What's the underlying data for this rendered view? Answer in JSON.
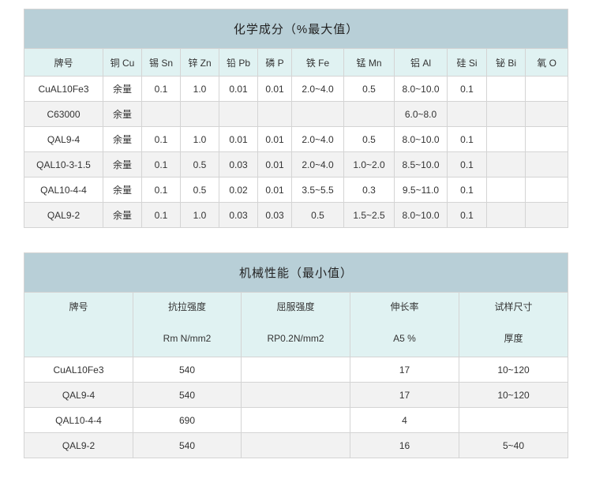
{
  "chem": {
    "title": "化学成分（%最大值）",
    "headers": [
      "牌号",
      "铜 Cu",
      "锡 Sn",
      "锌 Zn",
      "铅 Pb",
      "磷 P",
      "铁 Fe",
      "锰 Mn",
      "铝 Al",
      "硅 Si",
      "铋 Bi",
      "氧 O"
    ],
    "rows": [
      [
        "CuAL10Fe3",
        "余量",
        "0.1",
        "1.0",
        "0.01",
        "0.01",
        "2.0~4.0",
        "0.5",
        "8.0~10.0",
        "0.1",
        "",
        ""
      ],
      [
        "C63000",
        "余量",
        "",
        "",
        "",
        "",
        "",
        "",
        "6.0~8.0",
        "",
        "",
        ""
      ],
      [
        "QAL9-4",
        "余量",
        "0.1",
        "1.0",
        "0.01",
        "0.01",
        "2.0~4.0",
        "0.5",
        "8.0~10.0",
        "0.1",
        "",
        ""
      ],
      [
        "QAL10-3-1.5",
        "余量",
        "0.1",
        "0.5",
        "0.03",
        "0.01",
        "2.0~4.0",
        "1.0~2.0",
        "8.5~10.0",
        "0.1",
        "",
        ""
      ],
      [
        "QAL10-4-4",
        "余量",
        "0.1",
        "0.5",
        "0.02",
        "0.01",
        "3.5~5.5",
        "0.3",
        "9.5~11.0",
        "0.1",
        "",
        ""
      ],
      [
        "QAL9-2",
        "余量",
        "0.1",
        "1.0",
        "0.03",
        "0.03",
        "0.5",
        "1.5~2.5",
        "8.0~10.0",
        "0.1",
        "",
        ""
      ]
    ]
  },
  "mech": {
    "title": "机械性能（最小值）",
    "headers": [
      {
        "line1": "牌号",
        "line2": ""
      },
      {
        "line1": "抗拉强度",
        "line2": "Rm N/mm2"
      },
      {
        "line1": "屈服强度",
        "line2": "RP0.2N/mm2"
      },
      {
        "line1": "伸长率",
        "line2": "A5 %"
      },
      {
        "line1": "试样尺寸",
        "line2": "厚度"
      }
    ],
    "rows": [
      [
        "CuAL10Fe3",
        "540",
        "",
        "17",
        "10~120"
      ],
      [
        "QAL9-4",
        "540",
        "",
        "17",
        "10~120"
      ],
      [
        "QAL10-4-4",
        "690",
        "",
        "4",
        ""
      ],
      [
        "QAL9-2",
        "540",
        "",
        "16",
        "5~40"
      ]
    ]
  }
}
